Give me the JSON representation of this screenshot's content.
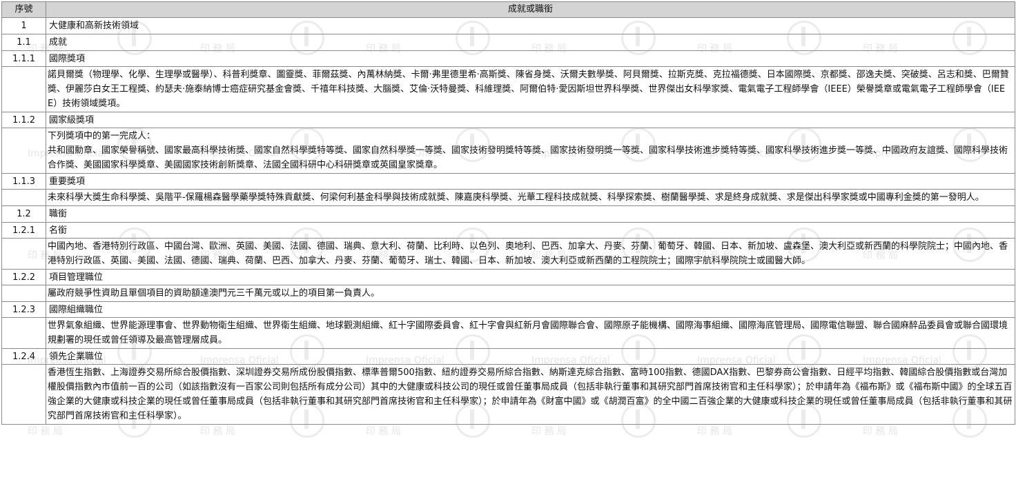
{
  "table": {
    "header": {
      "col1": "序號",
      "col2": "成就或職銜"
    },
    "rows": [
      {
        "no": "1",
        "title": "大健康和高新技術領域",
        "kind": "lvl1"
      },
      {
        "no": "1.1",
        "title": "成就",
        "kind": "lvl2"
      },
      {
        "no": "1.1.1",
        "title": "國際獎項",
        "kind": "lvl3"
      },
      {
        "no": "",
        "body": "諾貝爾獎（物理學、化學、生理學或醫學）、科普利獎章、圖靈獎、菲爾茲獎、內萬林納獎、卡爾·弗里德里希·高斯獎、陳省身獎、沃爾夫數學獎、阿貝爾獎、拉斯克獎、克拉福德獎、日本國際獎、京都獎、邵逸夫獎、突破獎、呂志和獎、巴爾贊獎、伊麗莎白女王工程獎、約瑟夫·施泰納博士癌症研究基金會獎、千禧年科技獎、大腦獎、艾倫·沃特曼獎、科維理獎、阿爾伯特·愛因斯坦世界科學獎、世界傑出女科學家獎、電氣電子工程師學會（IEEE）榮譽獎章或電氣電子工程師學會（IEEE）技術領域獎項。"
      },
      {
        "no": "1.1.2",
        "title": "國家級獎項",
        "kind": "lvl3"
      },
      {
        "no": "",
        "body": "下列獎項中的第一完成人：\n共和國勳章、國家榮譽稱號、國家最高科學技術獎、國家自然科學獎特等獎、國家自然科學獎一等獎、國家技術發明獎特等獎、國家技術發明獎一等獎、國家科學技術進步獎特等獎、國家科學技術進步獎一等獎、中國政府友誼獎、國際科學技術合作獎、美國國家科學獎章、美國國家技術創新獎章、法國全國科研中心科研獎章或英國皇家獎章。"
      },
      {
        "no": "1.1.3",
        "title": "重要獎項",
        "kind": "lvl3"
      },
      {
        "no": "",
        "body": "未來科學大獎生命科學獎、吳階平-保羅楊森醫學藥學獎特殊貢獻獎、何梁何利基金科學與技術成就獎、陳嘉庚科學獎、光華工程科技成就獎、科學探索獎、樹蘭醫學獎、求是終身成就獎、求是傑出科學家獎或中國專利金獎的第一發明人。"
      },
      {
        "no": "1.2",
        "title": "職銜",
        "kind": "lvl2"
      },
      {
        "no": "1.2.1",
        "title": "名銜",
        "kind": "lvl3"
      },
      {
        "no": "",
        "body": "中國內地、香港特別行政區、中國台灣、歐洲、英國、美國、法國、德國、瑞典、意大利、荷蘭、比利時、以色列、奧地利、巴西、加拿大、丹麥、芬蘭、葡萄牙、韓國、日本、新加坡、盧森堡、澳大利亞或新西蘭的科學院院士；中國內地、香港特別行政區、英國、美國、法國、德國、瑞典、荷蘭、巴西、加拿大、丹麥、芬蘭、葡萄牙、瑞士、韓國、日本、新加坡、澳大利亞或新西蘭的工程院院士；國際宇航科學院院士或國醫大師。"
      },
      {
        "no": "1.2.2",
        "title": "項目管理職位",
        "kind": "lvl3"
      },
      {
        "no": "",
        "body": "屬政府競爭性資助且單個項目的資助額達澳門元三千萬元或以上的項目第一負責人。"
      },
      {
        "no": "1.2.3",
        "title": "國際組織職位",
        "kind": "lvl3"
      },
      {
        "no": "",
        "body": "世界氣象組織、世界能源理事會、世界動物衛生組織、世界衛生組織、地球觀測組織、紅十字國際委員會、紅十字會與紅新月會國際聯合會、國際原子能機構、國際海事組織、國際海底管理局、國際電信聯盟、聯合國麻醉品委員會或聯合國環境規劃署的現任或曾任領導及最高管理層成員。"
      },
      {
        "no": "1.2.4",
        "title": "領先企業職位",
        "kind": "lvl3"
      },
      {
        "no": "",
        "body": "香港恆生指數、上海證券交易所綜合股價指數、深圳證券交易所成份股價指數、標準普爾500指數、紐約證券交易所綜合指數、納斯達克綜合指數、富時100指數、德國DAX指數、巴黎券商公會指數、日經平均指數、韓國綜合股價指數或台灣加權股價指數內市值前一百的公司（如該指數沒有一百家公司則包括所有成分公司）其中的大健康或科技公司的現任或曾任董事局成員（包括非執行董事和其研究部門首席技術官和主任科學家）；於申請年為《福布斯》或《福布斯中國》的全球五百強企業的大健康或科技企業的現任或曾任董事局成員（包括非執行董事和其研究部門首席技術官和主任科學家）；於申請年為《財富中國》或《胡潤百富》的全中國二百強企業的大健康或科技企業的現任或曾任董事局成員（包括非執行董事和其研究部門首席技術官和主任科學家）。"
      }
    ]
  },
  "watermark": {
    "text_latin": "Imprensa Oficial",
    "text_cjk": "印 務 局"
  }
}
